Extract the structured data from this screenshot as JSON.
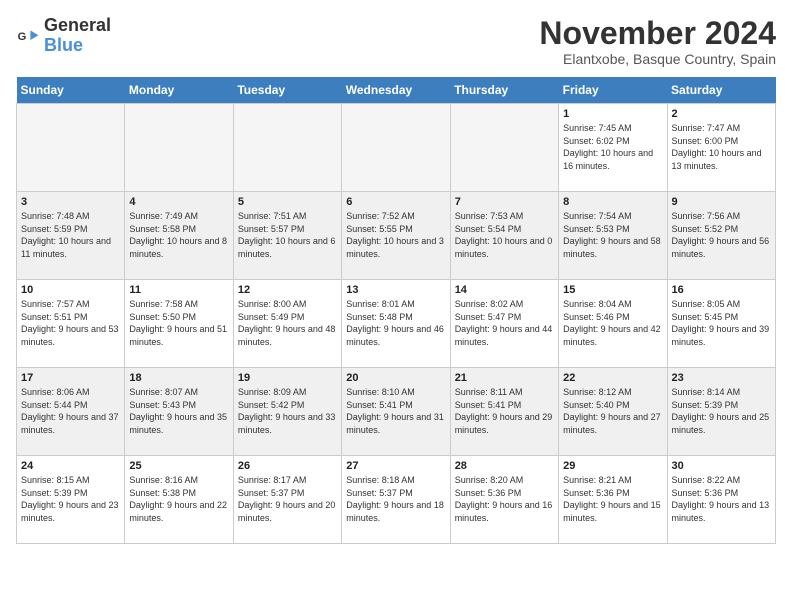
{
  "logo": {
    "general": "General",
    "blue": "Blue"
  },
  "header": {
    "month": "November 2024",
    "location": "Elantxobe, Basque Country, Spain"
  },
  "days_of_week": [
    "Sunday",
    "Monday",
    "Tuesday",
    "Wednesday",
    "Thursday",
    "Friday",
    "Saturday"
  ],
  "weeks": [
    [
      {
        "day": "",
        "info": ""
      },
      {
        "day": "",
        "info": ""
      },
      {
        "day": "",
        "info": ""
      },
      {
        "day": "",
        "info": ""
      },
      {
        "day": "",
        "info": ""
      },
      {
        "day": "1",
        "info": "Sunrise: 7:45 AM\nSunset: 6:02 PM\nDaylight: 10 hours and 16 minutes."
      },
      {
        "day": "2",
        "info": "Sunrise: 7:47 AM\nSunset: 6:00 PM\nDaylight: 10 hours and 13 minutes."
      }
    ],
    [
      {
        "day": "3",
        "info": "Sunrise: 7:48 AM\nSunset: 5:59 PM\nDaylight: 10 hours and 11 minutes."
      },
      {
        "day": "4",
        "info": "Sunrise: 7:49 AM\nSunset: 5:58 PM\nDaylight: 10 hours and 8 minutes."
      },
      {
        "day": "5",
        "info": "Sunrise: 7:51 AM\nSunset: 5:57 PM\nDaylight: 10 hours and 6 minutes."
      },
      {
        "day": "6",
        "info": "Sunrise: 7:52 AM\nSunset: 5:55 PM\nDaylight: 10 hours and 3 minutes."
      },
      {
        "day": "7",
        "info": "Sunrise: 7:53 AM\nSunset: 5:54 PM\nDaylight: 10 hours and 0 minutes."
      },
      {
        "day": "8",
        "info": "Sunrise: 7:54 AM\nSunset: 5:53 PM\nDaylight: 9 hours and 58 minutes."
      },
      {
        "day": "9",
        "info": "Sunrise: 7:56 AM\nSunset: 5:52 PM\nDaylight: 9 hours and 56 minutes."
      }
    ],
    [
      {
        "day": "10",
        "info": "Sunrise: 7:57 AM\nSunset: 5:51 PM\nDaylight: 9 hours and 53 minutes."
      },
      {
        "day": "11",
        "info": "Sunrise: 7:58 AM\nSunset: 5:50 PM\nDaylight: 9 hours and 51 minutes."
      },
      {
        "day": "12",
        "info": "Sunrise: 8:00 AM\nSunset: 5:49 PM\nDaylight: 9 hours and 48 minutes."
      },
      {
        "day": "13",
        "info": "Sunrise: 8:01 AM\nSunset: 5:48 PM\nDaylight: 9 hours and 46 minutes."
      },
      {
        "day": "14",
        "info": "Sunrise: 8:02 AM\nSunset: 5:47 PM\nDaylight: 9 hours and 44 minutes."
      },
      {
        "day": "15",
        "info": "Sunrise: 8:04 AM\nSunset: 5:46 PM\nDaylight: 9 hours and 42 minutes."
      },
      {
        "day": "16",
        "info": "Sunrise: 8:05 AM\nSunset: 5:45 PM\nDaylight: 9 hours and 39 minutes."
      }
    ],
    [
      {
        "day": "17",
        "info": "Sunrise: 8:06 AM\nSunset: 5:44 PM\nDaylight: 9 hours and 37 minutes."
      },
      {
        "day": "18",
        "info": "Sunrise: 8:07 AM\nSunset: 5:43 PM\nDaylight: 9 hours and 35 minutes."
      },
      {
        "day": "19",
        "info": "Sunrise: 8:09 AM\nSunset: 5:42 PM\nDaylight: 9 hours and 33 minutes."
      },
      {
        "day": "20",
        "info": "Sunrise: 8:10 AM\nSunset: 5:41 PM\nDaylight: 9 hours and 31 minutes."
      },
      {
        "day": "21",
        "info": "Sunrise: 8:11 AM\nSunset: 5:41 PM\nDaylight: 9 hours and 29 minutes."
      },
      {
        "day": "22",
        "info": "Sunrise: 8:12 AM\nSunset: 5:40 PM\nDaylight: 9 hours and 27 minutes."
      },
      {
        "day": "23",
        "info": "Sunrise: 8:14 AM\nSunset: 5:39 PM\nDaylight: 9 hours and 25 minutes."
      }
    ],
    [
      {
        "day": "24",
        "info": "Sunrise: 8:15 AM\nSunset: 5:39 PM\nDaylight: 9 hours and 23 minutes."
      },
      {
        "day": "25",
        "info": "Sunrise: 8:16 AM\nSunset: 5:38 PM\nDaylight: 9 hours and 22 minutes."
      },
      {
        "day": "26",
        "info": "Sunrise: 8:17 AM\nSunset: 5:37 PM\nDaylight: 9 hours and 20 minutes."
      },
      {
        "day": "27",
        "info": "Sunrise: 8:18 AM\nSunset: 5:37 PM\nDaylight: 9 hours and 18 minutes."
      },
      {
        "day": "28",
        "info": "Sunrise: 8:20 AM\nSunset: 5:36 PM\nDaylight: 9 hours and 16 minutes."
      },
      {
        "day": "29",
        "info": "Sunrise: 8:21 AM\nSunset: 5:36 PM\nDaylight: 9 hours and 15 minutes."
      },
      {
        "day": "30",
        "info": "Sunrise: 8:22 AM\nSunset: 5:36 PM\nDaylight: 9 hours and 13 minutes."
      }
    ]
  ]
}
